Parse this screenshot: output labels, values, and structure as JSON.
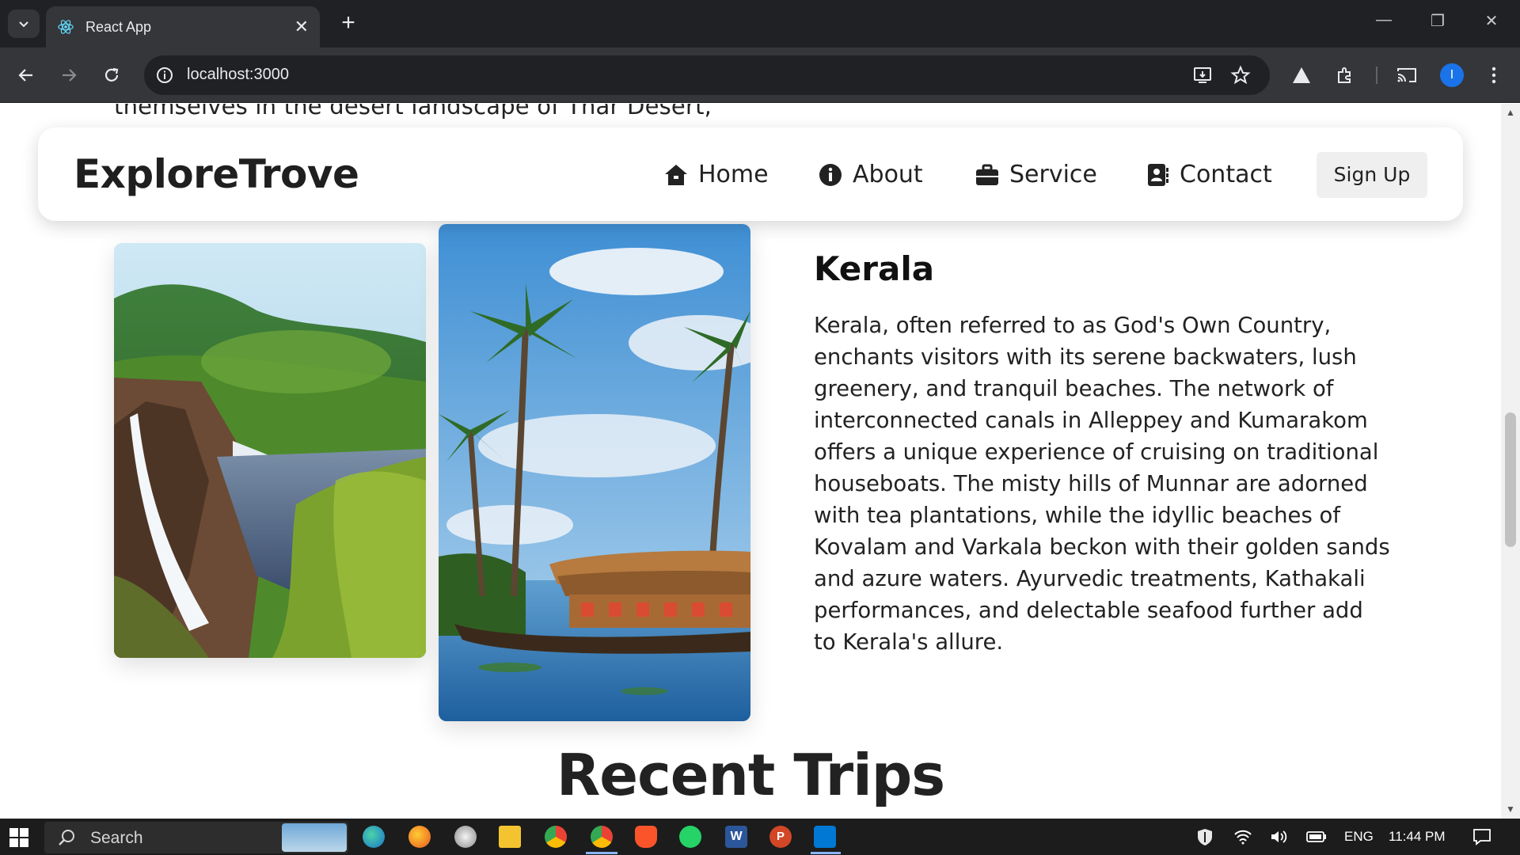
{
  "browser": {
    "tab_title": "React App",
    "url": "localhost:3000",
    "profile_initial": "I"
  },
  "page": {
    "previous_text": "themselves in the desert landscape of Thar Desert,",
    "nav": {
      "logo": "ExploreTrove",
      "items": [
        {
          "label": "Home",
          "icon": "home-icon"
        },
        {
          "label": "About",
          "icon": "info-icon"
        },
        {
          "label": "Service",
          "icon": "briefcase-icon"
        },
        {
          "label": "Contact",
          "icon": "contact-book-icon"
        }
      ],
      "signup": "Sign Up"
    },
    "destination": {
      "title": "Kerala",
      "description": "Kerala, often referred to as God's Own Country, enchants visitors with its serene backwaters, lush greenery, and tranquil beaches. The network of interconnected canals in Alleppey and Kumarakom offers a unique experience of cruising on traditional houseboats. The misty hills of Munnar are adorned with tea plantations, while the idyllic beaches of Kovalam and Varkala beckon with their golden sands and azure waters. Ayurvedic treatments, Kathakali performances, and delectable seafood further add to Kerala's allure."
    },
    "section_title": "Recent Trips"
  },
  "taskbar": {
    "search_label": "Search",
    "language": "ENG",
    "time": "11:44 PM"
  },
  "colors": {
    "chrome_dark": "#202124",
    "chrome_toolbar": "#35363a",
    "accent_blue": "#1a73e8"
  }
}
